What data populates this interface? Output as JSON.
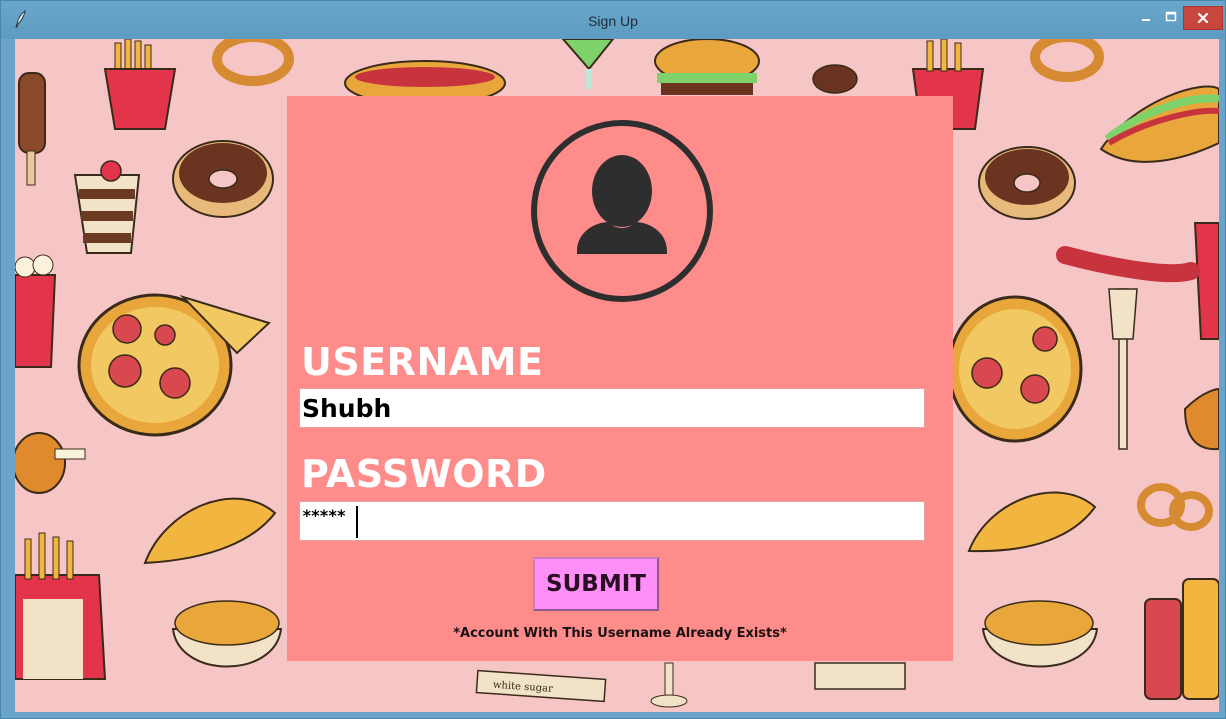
{
  "window": {
    "title": "Sign Up",
    "controls": {
      "minimize_icon": "minimize-icon",
      "maximize_icon": "maximize-icon",
      "close_icon": "close-icon"
    }
  },
  "form": {
    "avatar_icon": "user-avatar-icon",
    "username_label": "USERNAME",
    "username_value": "Shubh",
    "password_label": "PASSWORD",
    "password_masked": "*****",
    "submit_label": "SUBMIT",
    "status_message": "*Account With This Username Already Exists*"
  },
  "colors": {
    "background_pink": "#f6c6c6",
    "panel_salmon": "#fe8c8a",
    "submit_pink": "#ff8ff8",
    "titlebar_blue": "#5f9bc2",
    "close_red": "#c7463e"
  }
}
